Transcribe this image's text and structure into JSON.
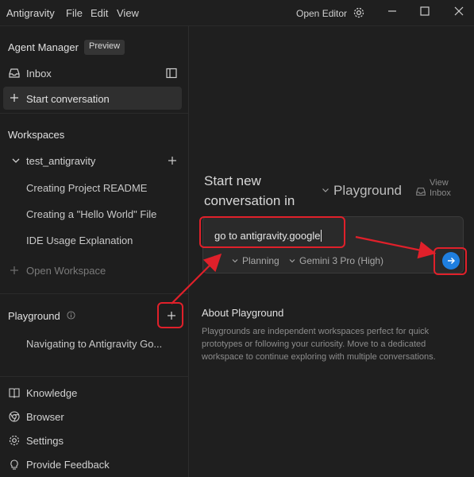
{
  "titlebar": {
    "app_name": "Antigravity",
    "menu": [
      "File",
      "Edit",
      "View"
    ],
    "open_editor": "Open Editor"
  },
  "sidebar": {
    "agent_manager": "Agent Manager",
    "preview_badge": "Preview",
    "inbox": "Inbox",
    "start_conversation": "Start conversation",
    "workspaces_title": "Workspaces",
    "workspace_name": "test_antigravity",
    "conversations": [
      "Creating Project README",
      "Creating a \"Hello World\" File",
      "IDE Usage Explanation"
    ],
    "open_workspace": "Open Workspace",
    "playground_title": "Playground",
    "playground_items": [
      "Navigating to Antigravity Go..."
    ],
    "bottom": [
      "Knowledge",
      "Browser",
      "Settings",
      "Provide Feedback"
    ]
  },
  "main": {
    "title_line1": "Start new",
    "title_line2": "conversation in",
    "target": "Playground",
    "view_inbox_1": "View",
    "view_inbox_2": "Inbox",
    "input_value": "go to antigravity.google",
    "mode": "Planning",
    "model": "Gemini 3 Pro (High)",
    "about_title": "About Playground",
    "about_text": "Playgrounds are independent workspaces perfect for quick prototypes or following your curiosity. Move to a dedicated workspace to continue exploring with multiple conversations."
  },
  "colors": {
    "accent": "#1f7fe0",
    "annotation": "#e0202a"
  }
}
